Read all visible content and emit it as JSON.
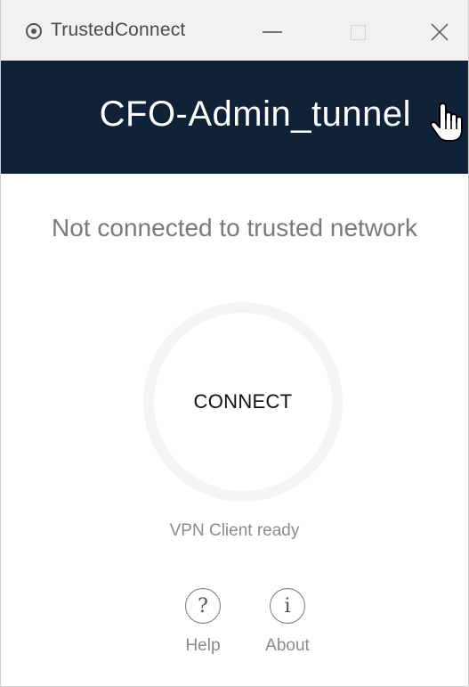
{
  "window": {
    "app_title": "TrustedConnect",
    "app_icon": "record-circle-icon",
    "controls": {
      "minimize": "minimize-icon",
      "maximize": "maximize-icon",
      "close": "close-icon"
    }
  },
  "header": {
    "tunnel_name": "CFO-Admin_tunnel",
    "background": "#0f2238"
  },
  "main": {
    "network_status": "Not connected to trusted network",
    "connect_label": "CONNECT",
    "client_status": "VPN Client ready"
  },
  "footer": {
    "help": {
      "icon": "question-circle-icon",
      "glyph": "?",
      "label": "Help"
    },
    "about": {
      "icon": "info-circle-icon",
      "glyph": "i",
      "label": "About"
    }
  }
}
